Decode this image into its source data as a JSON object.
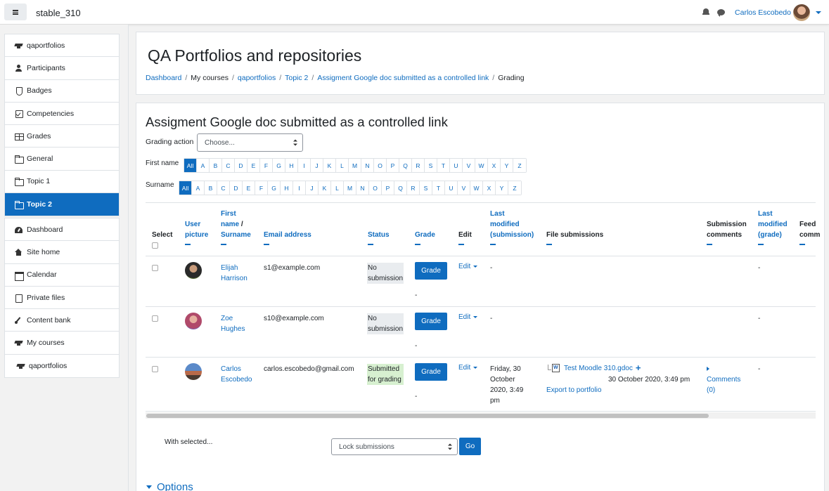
{
  "navbar": {
    "site_name": "stable_310",
    "user_name": "Carlos Escobedo"
  },
  "drawer": {
    "course_items": [
      {
        "label": "qaportfolios",
        "icon": "graduation-cap-icon"
      },
      {
        "label": "Participants",
        "icon": "users-icon"
      },
      {
        "label": "Badges",
        "icon": "shield-icon"
      },
      {
        "label": "Competencies",
        "icon": "check-square-icon"
      },
      {
        "label": "Grades",
        "icon": "table-icon"
      },
      {
        "label": "General",
        "icon": "folder-icon"
      },
      {
        "label": "Topic 1",
        "icon": "folder-icon"
      },
      {
        "label": "Topic 2",
        "icon": "folder-icon"
      }
    ],
    "site_items": [
      {
        "label": "Dashboard",
        "icon": "dashboard-icon"
      },
      {
        "label": "Site home",
        "icon": "home-icon"
      },
      {
        "label": "Calendar",
        "icon": "calendar-icon"
      },
      {
        "label": "Private files",
        "icon": "file-icon"
      },
      {
        "label": "Content bank",
        "icon": "brush-icon"
      },
      {
        "label": "My courses",
        "icon": "graduation-cap-icon"
      },
      {
        "label": "qaportfolios",
        "icon": "graduation-cap-icon"
      }
    ]
  },
  "header": {
    "title": "QA Portfolios and repositories",
    "breadcrumb": [
      "Dashboard",
      "My courses",
      "qaportfolios",
      "Topic 2",
      "Assigment Google doc submitted as a controlled link",
      "Grading"
    ]
  },
  "main": {
    "title": "Assigment Google doc submitted as a controlled link",
    "grading_action_label": "Grading action",
    "grading_action_value": "Choose...",
    "first_name_label": "First name",
    "surname_label": "Surname",
    "initials": [
      "All",
      "A",
      "B",
      "C",
      "D",
      "E",
      "F",
      "G",
      "H",
      "I",
      "J",
      "K",
      "L",
      "M",
      "N",
      "O",
      "P",
      "Q",
      "R",
      "S",
      "T",
      "U",
      "V",
      "W",
      "X",
      "Y",
      "Z"
    ],
    "columns": {
      "select": "Select",
      "user_picture_1": "User",
      "user_picture_2": "picture",
      "name_1": "First",
      "name_2": "name",
      "name_slash": " / ",
      "name_3": "Surname",
      "email": "Email address",
      "status": "Status",
      "grade": "Grade",
      "edit": "Edit",
      "last_mod_1": "Last",
      "last_mod_2": "modified",
      "last_mod_3": "(submission)",
      "file_submissions": "File submissions",
      "sub_comments_1": "Submission",
      "sub_comments_2": "comments",
      "last_mod_grade_1": "Last",
      "last_mod_grade_2": "modified",
      "last_mod_grade_3": "(grade)",
      "feedback_1": "Feed",
      "feedback_2": "comm"
    },
    "rows": [
      {
        "first": "Elijah",
        "last": "Harrison",
        "email": "s1@example.com",
        "status_1": "No",
        "status_2": "submission",
        "grade_button": "Grade",
        "grade_value": "-",
        "edit": "Edit",
        "last_modified": "-",
        "last_modified_grade": "-"
      },
      {
        "first": "Zoe",
        "last": "Hughes",
        "email": "s10@example.com",
        "status_1": "No",
        "status_2": "submission",
        "grade_button": "Grade",
        "grade_value": "-",
        "edit": "Edit",
        "last_modified": "-",
        "last_modified_grade": "-"
      },
      {
        "first": "Carlos",
        "last": "Escobedo",
        "email": "carlos.escobedo@gmail.com",
        "status_1": "Submitted",
        "status_2": "for grading",
        "grade_button": "Grade",
        "grade_value": "-",
        "edit": "Edit",
        "last_modified_1": "Friday, 30",
        "last_modified_2": "October",
        "last_modified_3": "2020, 3:49",
        "last_modified_4": "pm",
        "file_name": "Test Moodle 310.gdoc",
        "file_date": "30 October 2020, 3:49 pm",
        "export_label": "Export to portfolio",
        "comments_1": "Comments",
        "comments_2": "(0)",
        "last_modified_grade": "-"
      }
    ],
    "with_selected_label": "With selected...",
    "bulk_action_value": "Lock submissions",
    "go_label": "Go",
    "options_label": "Options"
  },
  "colors": {
    "primary": "#0f6cbf",
    "status_submitted": "#d7f0d0",
    "status_none": "#e9ecef"
  }
}
